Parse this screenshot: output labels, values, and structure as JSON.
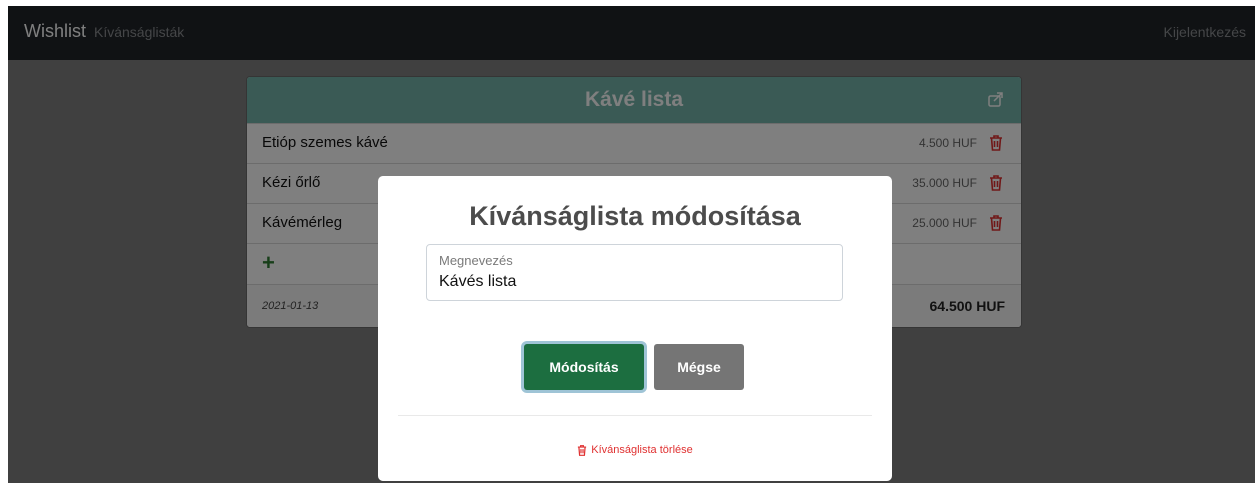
{
  "navbar": {
    "brand": "Wishlist",
    "nav_link": "Kívánságlisták",
    "logout": "Kijelentkezés"
  },
  "card": {
    "title": "Kávé lista",
    "items": [
      {
        "name": "Etióp szemes kávé",
        "price": "4.500 HUF"
      },
      {
        "name": "Kézi őrlő",
        "price": "35.000 HUF"
      },
      {
        "name": "Kávémérleg",
        "price": "25.000 HUF"
      }
    ],
    "add_symbol": "+",
    "date": "2021-01-13",
    "total": "64.500 HUF"
  },
  "modal": {
    "title": "Kívánságlista módosítása",
    "field_label": "Megnevezés",
    "field_value": "Kávés lista",
    "submit_label": "Módosítás",
    "cancel_label": "Mégse",
    "delete_label": "Kívánságlista törlése"
  },
  "colors": {
    "header_teal": "#74b4aa",
    "primary_green": "#1c6e40",
    "secondary_gray": "#757575",
    "danger_red": "#e03131",
    "navbar": "#212529"
  },
  "icons": {
    "share": "share-icon",
    "trash": "trash-icon",
    "plus": "plus-icon"
  }
}
